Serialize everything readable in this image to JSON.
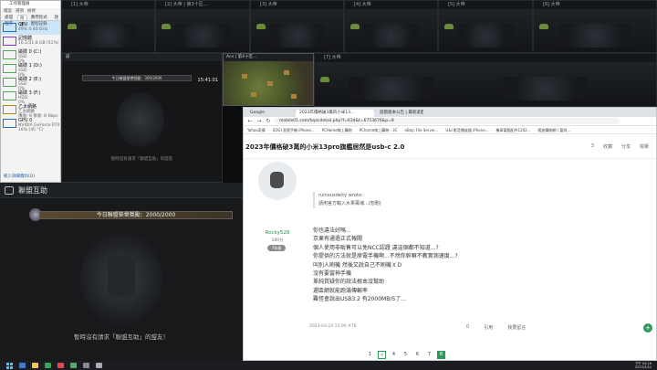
{
  "taskmgr": {
    "title": "工作管理員",
    "menu": [
      "檔案",
      "選項",
      "檢視"
    ],
    "tabs": [
      "處理程序",
      "效能",
      "應用程式歷程記錄",
      "啟"
    ],
    "items": [
      {
        "name": "CPU",
        "value": "49% 4.40 GHz",
        "color": "#1a73c6"
      },
      {
        "name": "記憶體",
        "value": "16.1/31.8 GB (51%)",
        "color": "#8a2be2"
      },
      {
        "name": "磁碟 0 (C:)",
        "value": "SSD\n0%",
        "color": "#4caf50"
      },
      {
        "name": "磁碟 1 (D:)",
        "value": "SSD\n0%",
        "color": "#4caf50"
      },
      {
        "name": "磁碟 2 (E:)",
        "value": "SSD\n0%",
        "color": "#4caf50"
      },
      {
        "name": "磁碟 3 (F:)",
        "value": "HDD\n0%",
        "color": "#4caf50"
      },
      {
        "name": "乙太網路",
        "value": "乙太網路\n傳送: 8 接收: 8 Kbps",
        "color": "#b8860b"
      },
      {
        "name": "GPU 0",
        "value": "NVIDIA GeForce RTX 30...\n16% (45 °C)",
        "color": "#1a73c6"
      }
    ],
    "footer": "較少詳細資料(D)"
  },
  "game_mid": {
    "title": "崩",
    "progress": "今日聯盟榮譽獎勵：300/2000",
    "clock": "15:41:01",
    "message": "暫時沒有請求「聯盟互助」的盟友"
  },
  "game_big": {
    "title": "聯盟互助",
    "progress": "今日聯盟榮譽獎勵：2000/2000",
    "progress_fraction": 1.0,
    "message": "暫時沒有請求「聯盟互助」的盟友！"
  },
  "game_map": {
    "title": "Ace | 第4十区..."
  },
  "tiles": [
    {
      "title": "[1] 大帝"
    },
    {
      "title": "[2] 大帝 | 第3十区..."
    },
    {
      "title": "[3] 大帝"
    },
    {
      "title": "[4] 大帝"
    },
    {
      "title": "[5] 大帝"
    },
    {
      "title": "[6] 大帝"
    },
    {
      "title": "[7] 大帝"
    }
  ],
  "browser": {
    "tabs": [
      "Google",
      "2023年價格破3萬的小米13...",
      "遊戲版本公告 | 最新遊戲..."
    ],
    "url": "mobile01.com/topicdetail.php?f=634&t=6753676&p=8",
    "bookmarks": [
      "Yahoo奇摩",
      "SOGI 直覺手機 iPhone...",
      "PCHome線上購物",
      "PChome線上購物 - 3C",
      "eBay: File Server...",
      "U&I 影音播放器 iPhone...",
      "機車電腦配件1202...",
      "蝦皮購物網 / 臺灣..."
    ],
    "topic_title": "2023年價格破3萬的小米13pro旗艦居然是usb-c 2.0",
    "topic_actions": [
      "3",
      "收藏",
      "分享",
      "檢舉"
    ],
    "quote_author": "ruinousdeity wrote:",
    "quote_text": "請用官方輸入水果萬塊...(恕刪)",
    "user_name": "Rocky528",
    "user_level": "189分",
    "user_badge": "7年資",
    "body_lines": [
      "你也違法好嗎...",
      "京東有通過正式報關",
      "個人使用非販售可以免NCC認證 違這個都不知道...?",
      "你提供的方法就是原電手機啊...不然你幹嘛不教實測速度...?",
      "叫別人刷機 然後又說自己不刷機ＸＤ",
      "沒有要當神手機",
      "單純質疑你的說法根本沒幫助",
      "還區網就能跑滿傳輸率",
      "難怪會說出USB3.2 有2000MB/S了..."
    ],
    "post_meta": "2023-03-24 15:00 #76",
    "post_actions": [
      "0",
      "引用",
      "我要留言"
    ],
    "pages": [
      "1",
      "<",
      "4",
      "5",
      "6",
      "7",
      "8"
    ],
    "current_page": "8"
  },
  "taskbar": {
    "time": "下午 04:16",
    "date": "2023/3/24"
  }
}
